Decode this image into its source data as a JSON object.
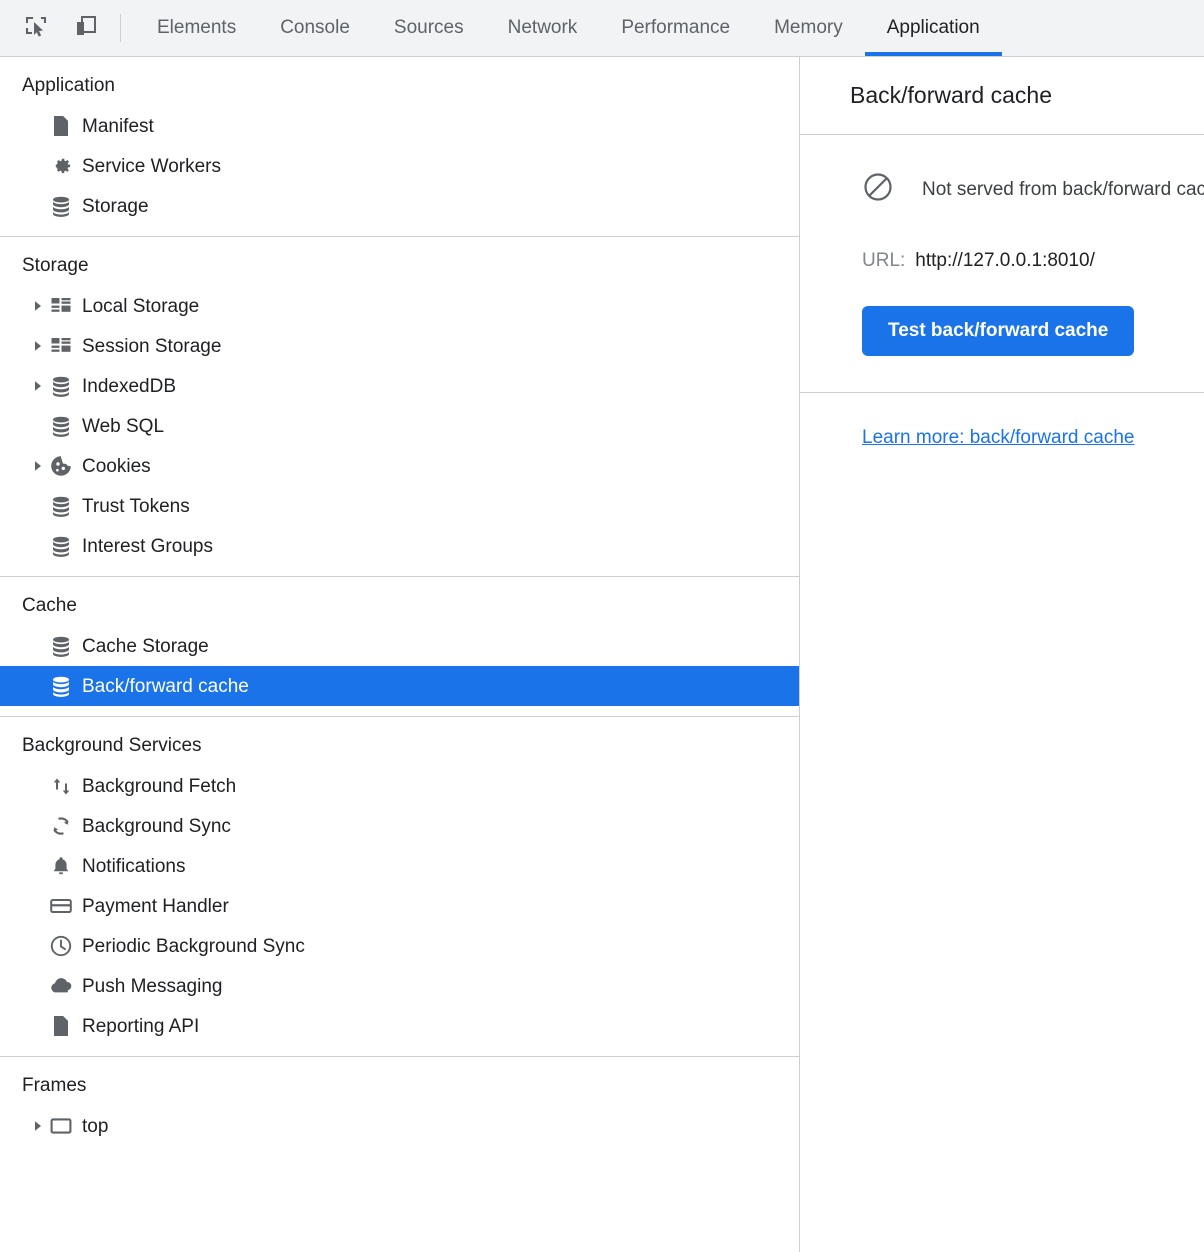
{
  "toolbar": {
    "inspect_icon": "inspect-element-icon",
    "device_icon": "device-toolbar-icon",
    "tabs": [
      {
        "label": "Elements",
        "selected": false
      },
      {
        "label": "Console",
        "selected": false
      },
      {
        "label": "Sources",
        "selected": false
      },
      {
        "label": "Network",
        "selected": false
      },
      {
        "label": "Performance",
        "selected": false
      },
      {
        "label": "Memory",
        "selected": false
      },
      {
        "label": "Application",
        "selected": true
      }
    ],
    "accent_color": "#1a73e8"
  },
  "sidebar": {
    "sections": [
      {
        "title": "Application",
        "items": [
          {
            "label": "Manifest",
            "icon": "document-icon",
            "expandable": false,
            "selected": false
          },
          {
            "label": "Service Workers",
            "icon": "gear-icon",
            "expandable": false,
            "selected": false
          },
          {
            "label": "Storage",
            "icon": "database-icon",
            "expandable": false,
            "selected": false
          }
        ]
      },
      {
        "title": "Storage",
        "items": [
          {
            "label": "Local Storage",
            "icon": "table-icon",
            "expandable": true,
            "selected": false
          },
          {
            "label": "Session Storage",
            "icon": "table-icon",
            "expandable": true,
            "selected": false
          },
          {
            "label": "IndexedDB",
            "icon": "database-icon",
            "expandable": true,
            "selected": false
          },
          {
            "label": "Web SQL",
            "icon": "database-icon",
            "expandable": false,
            "selected": false
          },
          {
            "label": "Cookies",
            "icon": "cookie-icon",
            "expandable": true,
            "selected": false
          },
          {
            "label": "Trust Tokens",
            "icon": "database-icon",
            "expandable": false,
            "selected": false
          },
          {
            "label": "Interest Groups",
            "icon": "database-icon",
            "expandable": false,
            "selected": false
          }
        ]
      },
      {
        "title": "Cache",
        "items": [
          {
            "label": "Cache Storage",
            "icon": "database-icon",
            "expandable": false,
            "selected": false
          },
          {
            "label": "Back/forward cache",
            "icon": "database-icon",
            "expandable": false,
            "selected": true
          }
        ]
      },
      {
        "title": "Background Services",
        "items": [
          {
            "label": "Background Fetch",
            "icon": "arrows-up-down-icon",
            "expandable": false,
            "selected": false
          },
          {
            "label": "Background Sync",
            "icon": "sync-icon",
            "expandable": false,
            "selected": false
          },
          {
            "label": "Notifications",
            "icon": "bell-icon",
            "expandable": false,
            "selected": false
          },
          {
            "label": "Payment Handler",
            "icon": "credit-card-icon",
            "expandable": false,
            "selected": false
          },
          {
            "label": "Periodic Background Sync",
            "icon": "clock-icon",
            "expandable": false,
            "selected": false
          },
          {
            "label": "Push Messaging",
            "icon": "cloud-icon",
            "expandable": false,
            "selected": false
          },
          {
            "label": "Reporting API",
            "icon": "document-icon",
            "expandable": false,
            "selected": false
          }
        ]
      },
      {
        "title": "Frames",
        "items": [
          {
            "label": "top",
            "icon": "frame-icon",
            "expandable": true,
            "selected": false
          }
        ]
      }
    ],
    "selected_color": "#1a73e8"
  },
  "panel": {
    "title": "Back/forward cache",
    "status_icon": "not-allowed-icon",
    "status_text": "Not served from back/forward cache",
    "url_label": "URL:",
    "url_value": "http://127.0.0.1:8010/",
    "test_button_label": "Test back/forward cache",
    "learn_more_label": "Learn more: back/forward cache",
    "link_color": "#1a73e8"
  }
}
